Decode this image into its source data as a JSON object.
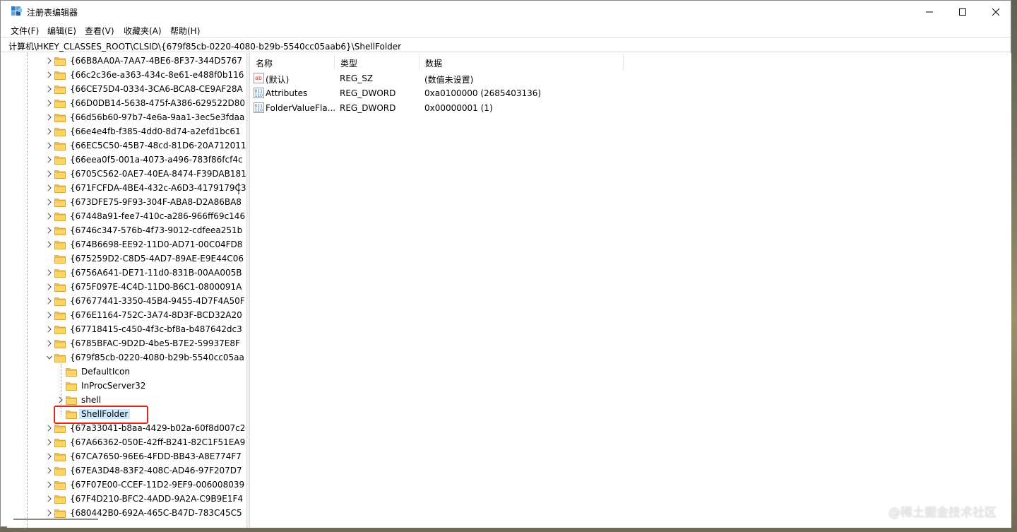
{
  "window": {
    "title": "注册表编辑器",
    "minimize": "—",
    "maximize": "☐",
    "close": "✕"
  },
  "menu": [
    "文件(F)",
    "编辑(E)",
    "查看(V)",
    "收藏夹(A)",
    "帮助(H)"
  ],
  "address": "计算机\\HKEY_CLASSES_ROOT\\CLSID\\{679f85cb-0220-4080-b29b-5540cc05aab6}\\ShellFolder",
  "tree": {
    "keys_before": [
      "{66B8AA0A-7AA7-4BE6-8F37-344D5767",
      "{66c2c36e-a363-434c-8e61-e488f0b116",
      "{66CE75D4-0334-3CA6-BCA8-CE9AF28A",
      "{66D0DB14-5638-475f-A386-629522D80",
      "{66d56b60-97b7-4e6a-9aa1-3ec5e3fdaa",
      "{66e4e4fb-f385-4dd0-8d74-a2efd1bc61",
      "{66EC5C50-45B7-48cd-81D6-20A712011",
      "{66eea0f5-001a-4073-a496-783f86fcf4c",
      "{6705C562-0AE7-40EA-8474-F39DAB181",
      "{671FCFDA-4BE4-432c-A6D3-4179179C3",
      "{673DFE75-9F93-304F-ABA8-D2A86BA8",
      "{67448a91-fee7-410c-a286-966ff69c146",
      "{6746c347-576b-4f73-9012-cdfeea251b",
      "{674B6698-EE92-11D0-AD71-00C04FD8",
      "{675259D2-C8D5-4AD7-89AE-E9E44C06",
      "{6756A641-DE71-11d0-831B-00AA005B",
      "{675F097E-4C4D-11D0-B6C1-0800091A",
      "{67677441-3350-45B4-9455-4D7F4A50F",
      "{676E1164-752C-3A74-8D3F-BCD32A20",
      "{67718415-c450-4f3c-bf8a-b487642dc3",
      "{6785BFAC-9D2D-4be5-B7E2-59937E8F",
      "{679f85cb-0220-4080-b29b-5540cc05aa"
    ],
    "expanded_children": [
      "DefaultIcon",
      "InProcServer32",
      "shell",
      "ShellFolder"
    ],
    "keys_after": [
      "{67a33041-b8aa-4429-b02a-60f8d007c2",
      "{67A66362-050E-42ff-B241-82C1F51EA9",
      "{67CA7650-96E6-4FDD-BB43-A8E774F7",
      "{67EA3D48-83F2-408C-AD46-97F207D7",
      "{67F07E00-CCEF-11D2-9EF9-006008039",
      "{67F4D210-BFC2-4ADD-9A2A-C9B9E1F4",
      "{680442B0-692A-465C-B47D-783C45C5"
    ]
  },
  "values": {
    "columns": [
      "名称",
      "类型",
      "数据"
    ],
    "rows": [
      {
        "icon": "string-value-icon",
        "name": "(默认)",
        "type": "REG_SZ",
        "data": "(数值未设置)"
      },
      {
        "icon": "binary-value-icon",
        "name": "Attributes",
        "type": "REG_DWORD",
        "data": "0xa0100000 (2685403136)"
      },
      {
        "icon": "binary-value-icon",
        "name": "FolderValueFla...",
        "type": "REG_DWORD",
        "data": "0x00000001 (1)"
      }
    ]
  },
  "watermark": "@稀土掘金技术社区",
  "colors": {
    "folder": "#f6c84c",
    "selection": "#cce8ff",
    "highlight_border": "#e0261c",
    "accent": "#0078d4"
  }
}
